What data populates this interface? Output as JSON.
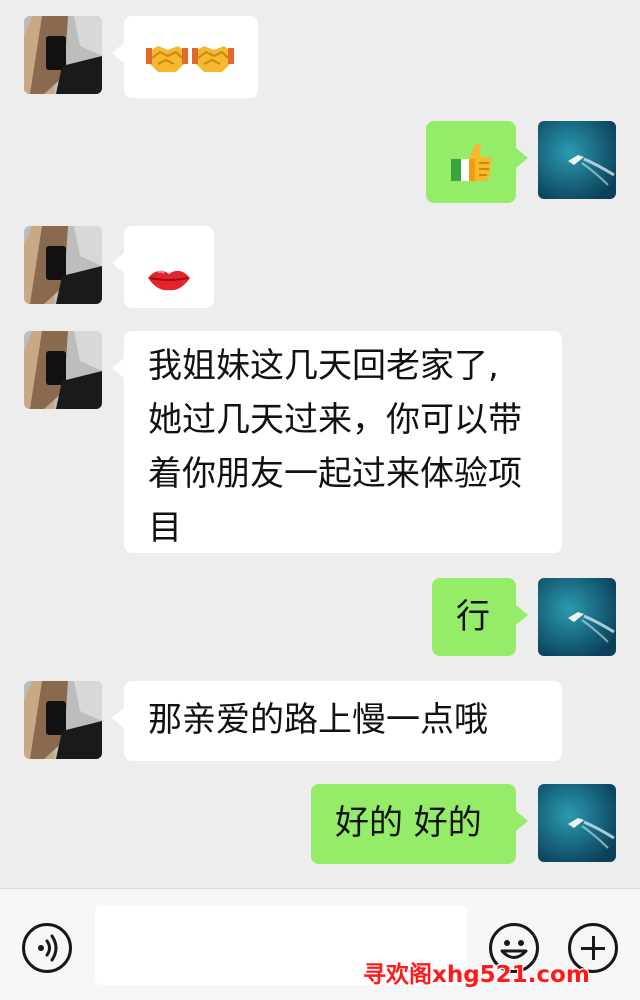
{
  "messages": [
    {
      "side": "in",
      "content": "emoji",
      "emoji": "handshake-handshake"
    },
    {
      "side": "out",
      "content": "emoji",
      "emoji": "thumbs-up"
    },
    {
      "side": "in",
      "content": "emoji",
      "emoji": "lips"
    },
    {
      "side": "in",
      "content": "text",
      "lines": [
        "我姐妹这几天回老家了,",
        "她过几天过来，你可以带",
        "着你朋友一起过来体验项",
        "目"
      ]
    },
    {
      "side": "out",
      "content": "text",
      "text": "行"
    },
    {
      "side": "in",
      "content": "text",
      "text": "那亲爱的路上慢一点哦"
    },
    {
      "side": "out",
      "content": "text",
      "text": "好的 好的"
    }
  ],
  "input": {
    "voice_icon": "voice-icon",
    "emoji_icon": "smile-icon",
    "plus_icon": "plus-icon",
    "value": ""
  },
  "watermark": "寻欢阁xhg521.com",
  "colors": {
    "background": "#ededed",
    "incoming_bubble": "#ffffff",
    "outgoing_bubble": "#95ec69",
    "watermark": "#ff1a1a"
  }
}
